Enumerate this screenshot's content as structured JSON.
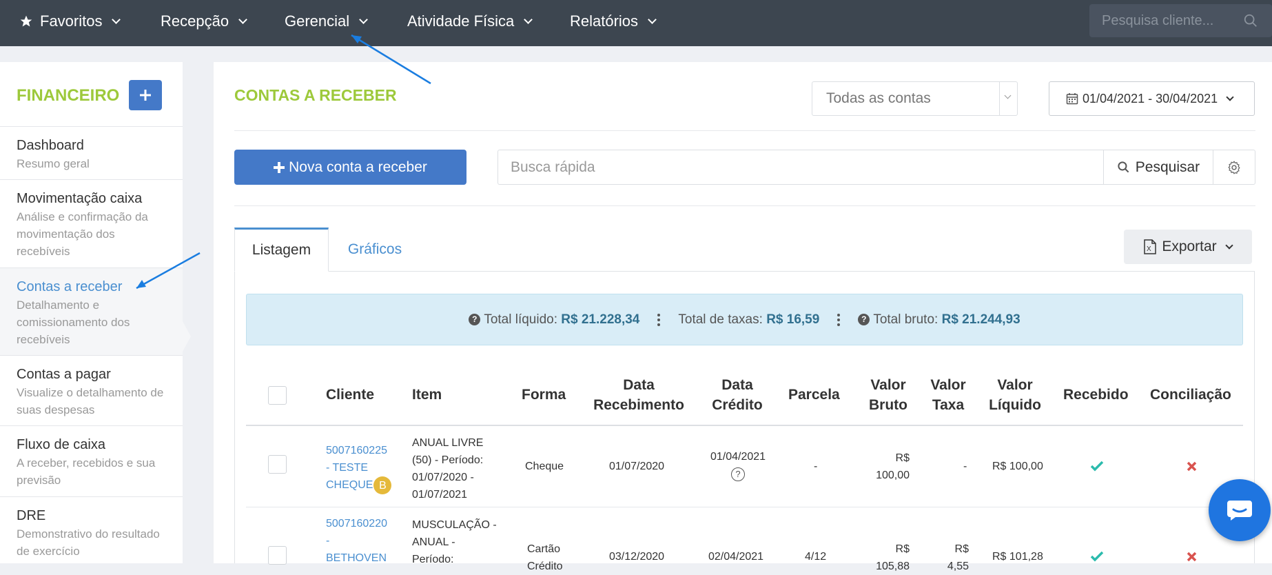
{
  "nav": {
    "items": [
      {
        "label": "Favoritos",
        "icon": "star-icon"
      },
      {
        "label": "Recepção"
      },
      {
        "label": "Gerencial"
      },
      {
        "label": "Atividade Física"
      },
      {
        "label": "Relatórios"
      }
    ],
    "search_placeholder": "Pesquisa cliente..."
  },
  "sidebar": {
    "title": "FINANCEIRO",
    "items": [
      {
        "title": "Dashboard",
        "subtitle": "Resumo geral"
      },
      {
        "title": "Movimentação caixa",
        "subtitle": "Análise e confirmação da movimentação dos recebíveis"
      },
      {
        "title": "Contas a receber",
        "subtitle": "Detalhamento e comissionamento dos recebíveis"
      },
      {
        "title": "Contas a pagar",
        "subtitle": "Visualize o detalhamento de suas despesas"
      },
      {
        "title": "Fluxo de caixa",
        "subtitle": "A receber, recebidos e sua previsão"
      },
      {
        "title": "DRE",
        "subtitle": "Demonstrativo do resultado de exercício"
      }
    ]
  },
  "main": {
    "title": "CONTAS A RECEBER",
    "account_select": "Todas as contas",
    "date_range": "01/04/2021 - 30/04/2021",
    "new_button": "Nova conta a receber",
    "quick_search_placeholder": "Busca rápida",
    "search_button": "Pesquisar",
    "tabs": [
      "Listagem",
      "Gráficos"
    ],
    "export_button": "Exportar"
  },
  "totals": {
    "net_label": "Total líquido:",
    "net_value": "R$ 21.228,34",
    "fees_label": "Total de taxas:",
    "fees_value": "R$ 16,59",
    "gross_label": "Total bruto:",
    "gross_value": "R$ 21.244,93"
  },
  "table": {
    "headers": {
      "cliente": "Cliente",
      "item": "Item",
      "forma": "Forma",
      "data_recebimento_1": "Data",
      "data_recebimento_2": "Recebimento",
      "data_credito_1": "Data",
      "data_credito_2": "Crédito",
      "parcela": "Parcela",
      "valor_bruto_1": "Valor",
      "valor_bruto_2": "Bruto",
      "valor_taxa_1": "Valor",
      "valor_taxa_2": "Taxa",
      "valor_liquido_1": "Valor",
      "valor_liquido_2": "Líquido",
      "recebido": "Recebido",
      "conciliacao": "Conciliação"
    },
    "rows": [
      {
        "cliente_l1": "5007160225",
        "cliente_l2": "- TESTE",
        "cliente_l3": "CHEQUE",
        "badge": "B",
        "item_l1": "ANUAL LIVRE",
        "item_l2": "(50) - Período:",
        "item_l3": "01/07/2020 -",
        "item_l4": "01/07/2021",
        "forma": "Cheque",
        "data_recebimento": "01/07/2020",
        "data_credito": "01/04/2021",
        "parcela": "-",
        "valor_bruto_l1": "R$",
        "valor_bruto_l2": "100,00",
        "valor_taxa": "-",
        "valor_liquido": "R$ 100,00",
        "recebido": "check",
        "conciliacao": "cross"
      },
      {
        "cliente_l1": "5007160220",
        "cliente_l2": "-",
        "cliente_l3": "BETHOVEN",
        "item_l1": "MUSCULAÇÃO -",
        "item_l2": "ANUAL -",
        "item_l3": "Período:",
        "forma_l1": "Cartão",
        "forma_l2": "Crédito",
        "data_recebimento": "03/12/2020",
        "data_credito": "02/04/2021",
        "parcela": "4/12",
        "valor_bruto_l1": "R$",
        "valor_bruto_l2": "105,88",
        "valor_taxa_l1": "R$",
        "valor_taxa_l2": "4,55",
        "valor_liquido": "R$ 101,28",
        "recebido": "check",
        "conciliacao": "cross"
      }
    ]
  },
  "colors": {
    "topbar": "#3d4650",
    "accent_green": "#9dc93b",
    "primary_blue": "#4479c8",
    "link_blue": "#4a8fd0",
    "info_bg": "#d9edf7",
    "check": "#2bbbad",
    "cross": "#d9534f",
    "chat": "#1f75e0"
  }
}
